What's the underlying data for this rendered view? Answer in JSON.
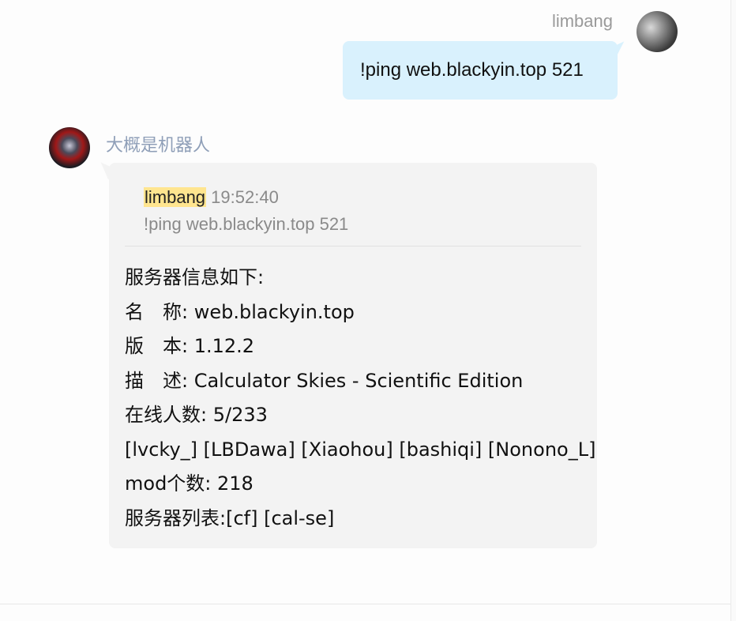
{
  "outgoing": {
    "sender": "limbang",
    "text": "!ping web.blackyin.top 521"
  },
  "incoming": {
    "sender": "大概是机器人",
    "quote": {
      "user": "limbang",
      "time": "19:52:40",
      "text": "!ping web.blackyin.top 521"
    },
    "lines": [
      "服务器信息如下:",
      "名　称: web.blackyin.top",
      "版　本: 1.12.2",
      "描　述: Calculator Skies - Scientific Edition",
      "在线人数: 5/233",
      "[lvcky_] [LBDawa] [Xiaohou] [bashiqi] [Nonono_L]",
      "mod个数: 218",
      "服务器列表:[cf] [cal-se]"
    ]
  },
  "colors": {
    "outgoing_bubble": "#d9f1fd",
    "incoming_bubble": "#f3f3f3",
    "quote_highlight": "#ffe58f",
    "bot_name": "#8f9fb8"
  }
}
